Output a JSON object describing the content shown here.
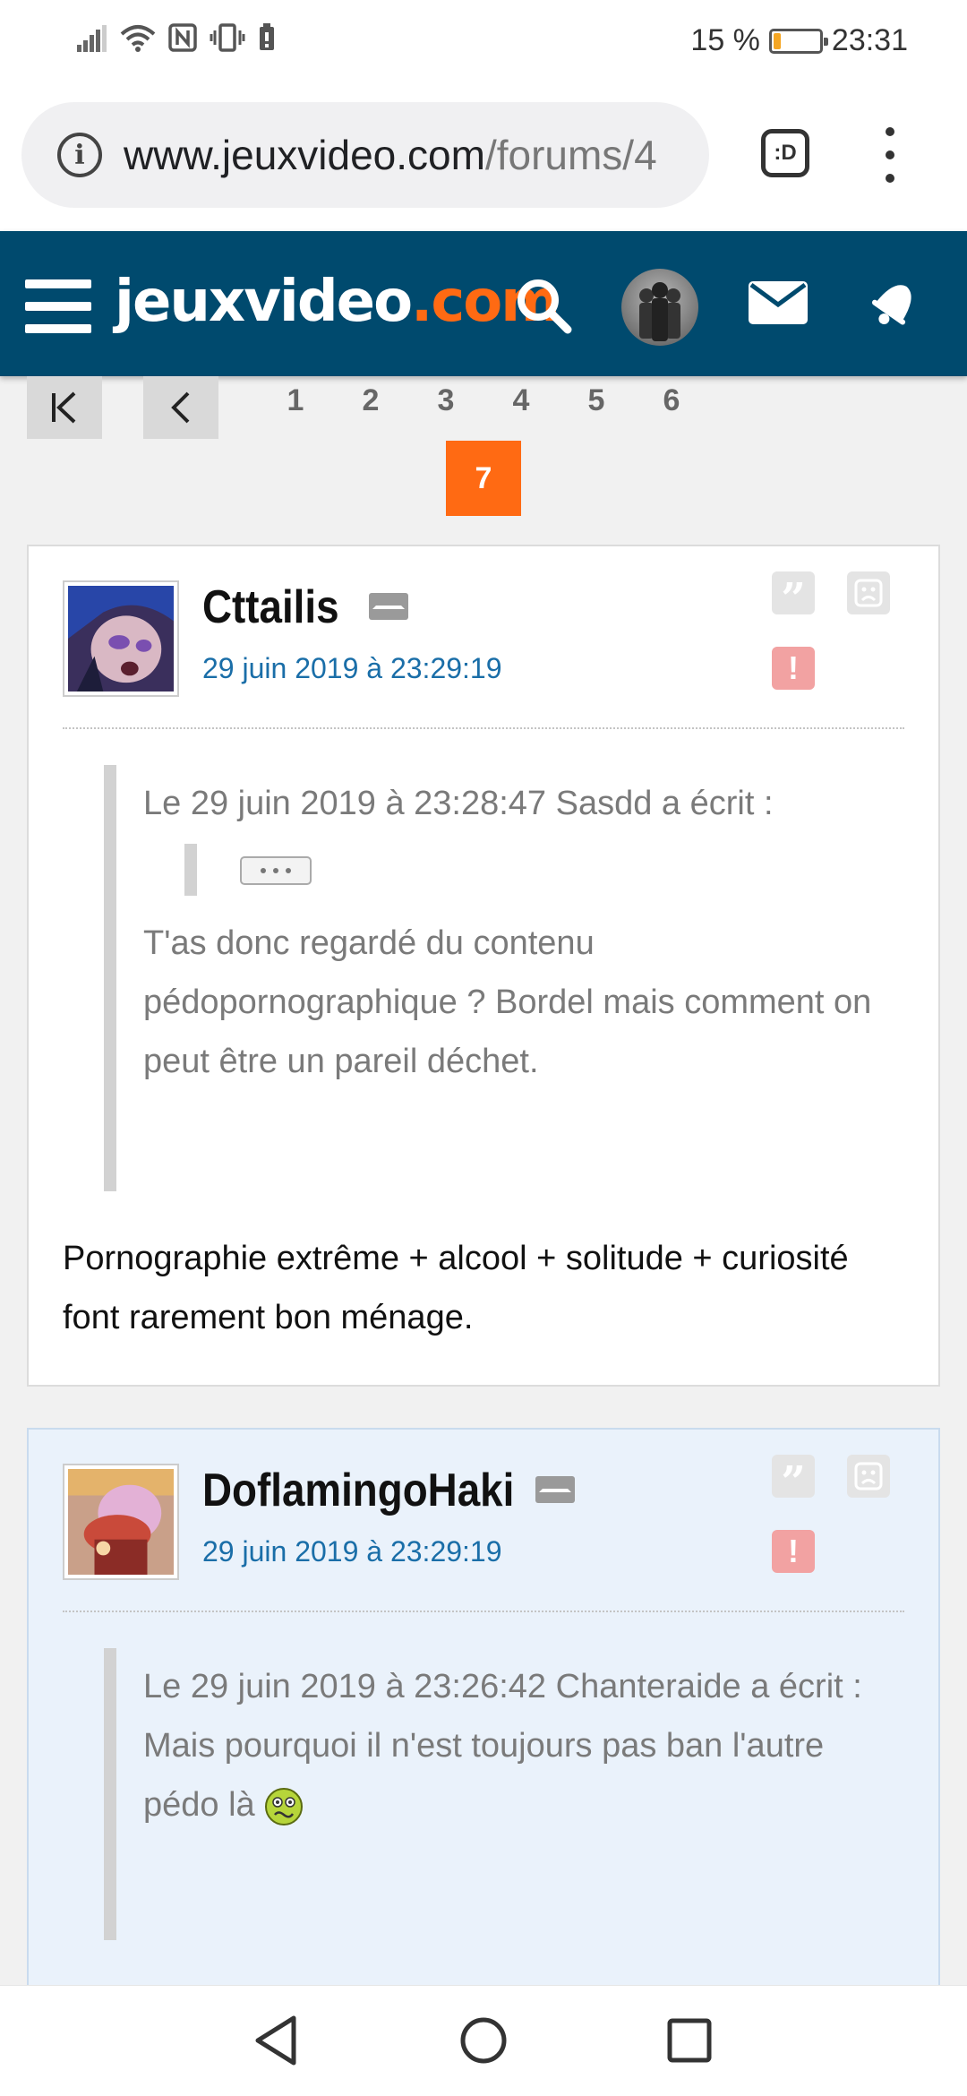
{
  "status_bar": {
    "battery_text": "15 %",
    "battery_level": 0.15,
    "time": "23:31",
    "icons": [
      "signal-icon",
      "wifi-icon",
      "nfc-icon",
      "vibrate-icon",
      "battery-saver-icon"
    ]
  },
  "browser": {
    "url_host": "www.jeuxvideo.com",
    "url_path": "/forums/4",
    "tabs_label": ":D"
  },
  "site": {
    "logo_main": "jeuxvideo",
    "logo_accent": ".com",
    "accent_color": "#ff6a13",
    "header_color": "#004a6e"
  },
  "pagination": {
    "pages": [
      "1",
      "2",
      "3",
      "4",
      "5",
      "6"
    ],
    "current": "7"
  },
  "posts": [
    {
      "author": "Cttailis",
      "date": "29 juin 2019 à 23:29:19",
      "quote_header": "Le 29 juin 2019 à 23:28:47 Sasdd a écrit :",
      "quote_text": "T'as donc regardé du contenu pédopornographique ? Bordel mais comment on peut être un pareil déchet.",
      "body": "Pornographie extrême + alcool + solitude + curiosité font rarement bon ménage."
    },
    {
      "author": "DoflamingoHaki",
      "date": "29 juin 2019 à 23:29:19",
      "quote_header": "Le 29 juin 2019 à 23:26:42 Chanteraide a écrit :",
      "quote_text": "Mais pourquoi il n'est toujours pas ban l'autre pédo là"
    }
  ]
}
